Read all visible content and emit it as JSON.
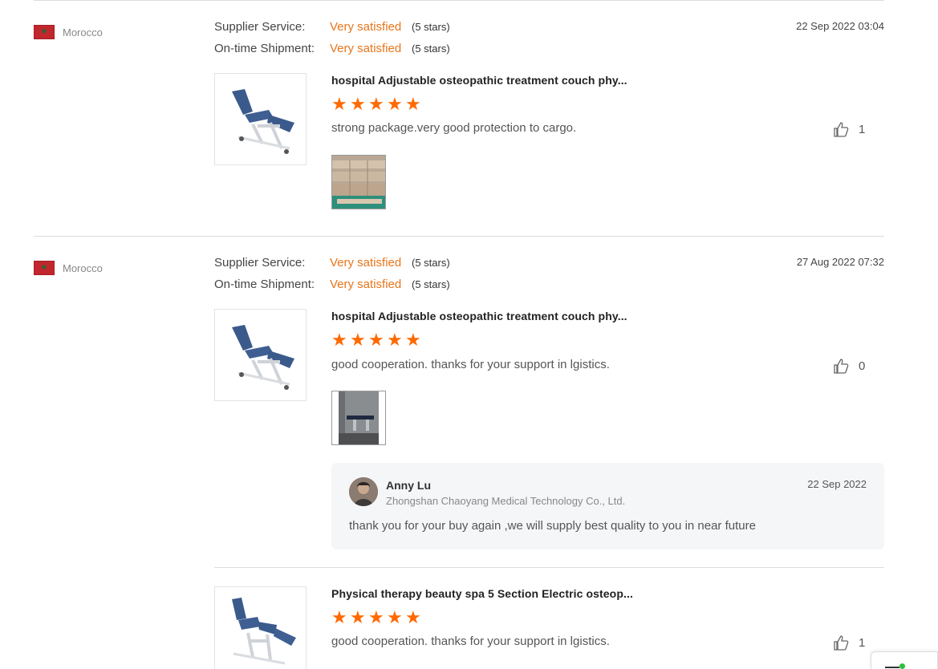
{
  "reviews": [
    {
      "country": "Morocco",
      "supplier_service_label": "Supplier Service:",
      "supplier_service_value": "Very satisfied",
      "supplier_service_stars": "(5 stars)",
      "shipment_label": "On-time Shipment:",
      "shipment_value": "Very satisfied",
      "shipment_stars": "(5 stars)",
      "date": "22 Sep 2022 03:04",
      "product_title": "hospital Adjustable osteopathic treatment couch phy...",
      "rating": 5,
      "comment": "strong package.very good protection to cargo.",
      "likes": "1"
    },
    {
      "country": "Morocco",
      "supplier_service_label": "Supplier Service:",
      "supplier_service_value": "Very satisfied",
      "supplier_service_stars": "(5 stars)",
      "shipment_label": "On-time Shipment:",
      "shipment_value": "Very satisfied",
      "shipment_stars": "(5 stars)",
      "date": "27 Aug 2022 07:32",
      "product_title": "hospital Adjustable osteopathic treatment couch phy...",
      "rating": 5,
      "comment": "good cooperation. thanks for your support in lgistics.",
      "likes": "0",
      "reply": {
        "name": "Anny Lu",
        "company": "Zhongshan Chaoyang Medical Technology Co., Ltd.",
        "date": "22 Sep 2022",
        "text": "thank you for your buy again ,we will supply best quality to you in near future"
      }
    },
    {
      "product_title": "Physical therapy beauty spa 5 Section Electric osteop...",
      "rating": 5,
      "comment": "good cooperation. thanks for your support in lgistics.",
      "likes": "1"
    }
  ],
  "colors": {
    "accent_orange": "#e8751a",
    "star_orange": "#ff6a00",
    "divider": "#dcdcdc",
    "reply_bg": "#f5f6f8"
  },
  "icons": {
    "flag": "morocco-flag-icon",
    "like": "thumbs-up-icon",
    "star": "star-icon"
  }
}
